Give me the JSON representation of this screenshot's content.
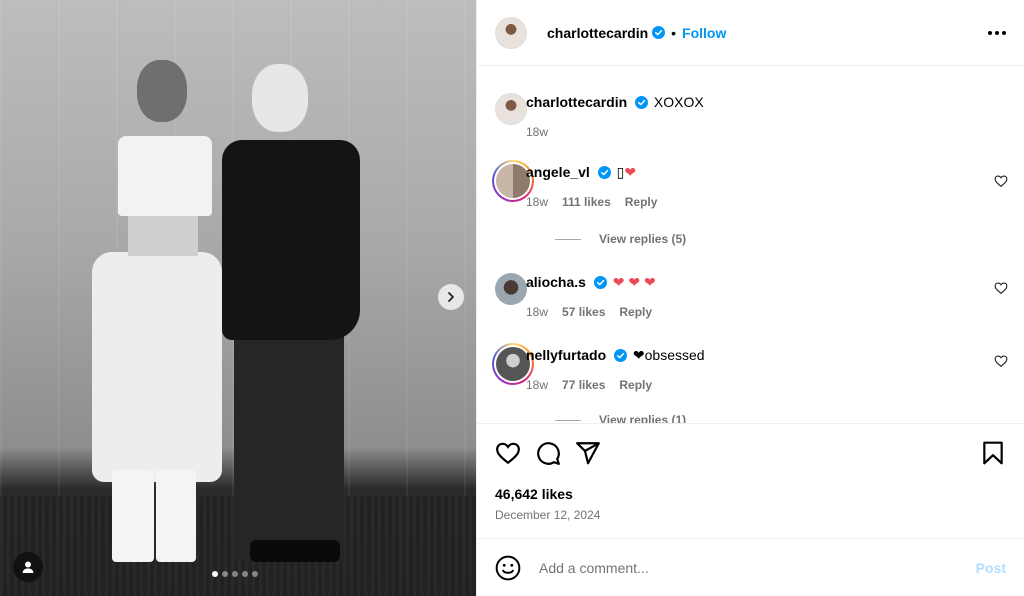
{
  "header": {
    "username": "charlottecardin",
    "separator": "•",
    "follow_label": "Follow"
  },
  "caption": {
    "username": "charlottecardin",
    "text": "XOXOX",
    "age": "18w"
  },
  "comments": [
    {
      "username": "angele_vl",
      "text": "❤",
      "lead_glyph": "▯",
      "age": "18w",
      "likes": "111 likes",
      "reply": "Reply",
      "view_replies": "View replies (5)",
      "story_ring": true
    },
    {
      "username": "aliocha.s",
      "text": "❤ ❤ ❤",
      "age": "18w",
      "likes": "57 likes",
      "reply": "Reply",
      "story_ring": false
    },
    {
      "username": "nellyfurtado",
      "text": "❤obsessed",
      "age": "18w",
      "likes": "77 likes",
      "reply": "Reply",
      "view_replies": "View replies (1)",
      "story_ring": true
    }
  ],
  "post": {
    "likes": "46,642 likes",
    "date": "December 12, 2024"
  },
  "add_comment": {
    "placeholder": "Add a comment...",
    "post_label": "Post"
  },
  "carousel": {
    "total": 5,
    "active_index": 0
  },
  "colors": {
    "accent": "#0095f6",
    "verified": "#0095f6",
    "heart": "#ed4956",
    "post_disabled": "#b2dffc"
  },
  "icons": [
    "chevron-right-icon",
    "user-tag-icon",
    "verified-icon",
    "more-icon",
    "heart-icon",
    "comment-icon",
    "share-icon",
    "bookmark-icon",
    "emoji-icon"
  ]
}
